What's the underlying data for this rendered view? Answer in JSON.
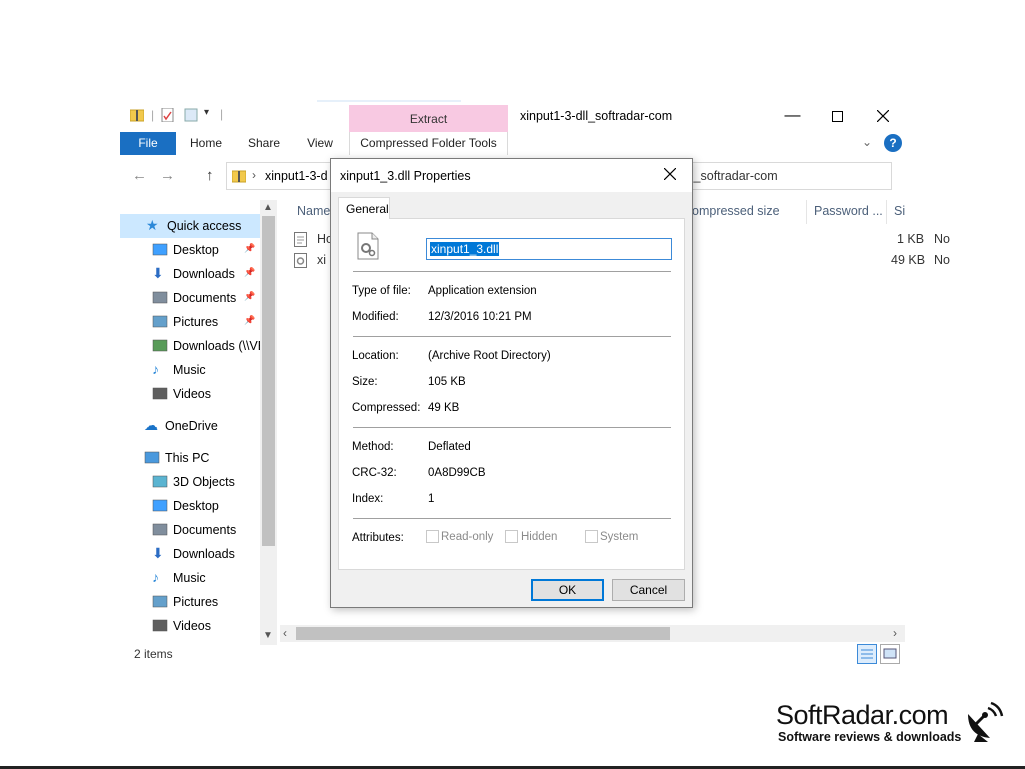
{
  "explorer": {
    "title": "xinput1-3-dll_softradar-com",
    "context_tab": "Extract",
    "context_group": "Compressed Folder Tools",
    "tabs": [
      "File",
      "Home",
      "Share",
      "View"
    ],
    "address_left": "xinput1-3-d",
    "address_right": "ll_softradar-com",
    "columns": {
      "name": "Name",
      "compressed_size": "ompressed size",
      "password": "Password ...",
      "size": "Si"
    },
    "files": [
      {
        "name": "Ho",
        "compressed_size": "1 KB",
        "password": "No"
      },
      {
        "name": "xi",
        "compressed_size": "49 KB",
        "password": "No"
      }
    ],
    "nav": [
      {
        "label": "Quick access",
        "icon": "star-icon",
        "pinned": false
      },
      {
        "label": "Desktop",
        "icon": "desktop-icon",
        "pinned": true
      },
      {
        "label": "Downloads",
        "icon": "download-arrow-icon",
        "pinned": true
      },
      {
        "label": "Documents",
        "icon": "document-icon",
        "pinned": true
      },
      {
        "label": "Pictures",
        "icon": "pictures-icon",
        "pinned": true
      },
      {
        "label": "Downloads (\\\\VE",
        "icon": "network-drive-icon",
        "pinned": false
      },
      {
        "label": "Music",
        "icon": "music-note-icon",
        "pinned": false
      },
      {
        "label": "Videos",
        "icon": "video-film-icon",
        "pinned": false
      },
      {
        "label": "OneDrive",
        "icon": "cloud-icon",
        "pinned": false
      },
      {
        "label": "This PC",
        "icon": "computer-icon",
        "pinned": false
      },
      {
        "label": "3D Objects",
        "icon": "cube-icon",
        "pinned": false
      },
      {
        "label": "Desktop",
        "icon": "desktop-icon",
        "pinned": false
      },
      {
        "label": "Documents",
        "icon": "document-icon",
        "pinned": false
      },
      {
        "label": "Downloads",
        "icon": "download-arrow-icon",
        "pinned": false
      },
      {
        "label": "Music",
        "icon": "music-note-icon",
        "pinned": false
      },
      {
        "label": "Pictures",
        "icon": "pictures-icon",
        "pinned": false
      },
      {
        "label": "Videos",
        "icon": "video-film-icon",
        "pinned": false
      }
    ],
    "status": "2 items"
  },
  "dialog": {
    "title": "xinput1_3.dll Properties",
    "tab": "General",
    "filename": "xinput1_3.dll",
    "props": {
      "type_label": "Type of file:",
      "type_value": "Application extension",
      "modified_label": "Modified:",
      "modified_value": "12/3/2016 10:21 PM",
      "location_label": "Location:",
      "location_value": "(Archive Root Directory)",
      "size_label": "Size:",
      "size_value": "105 KB",
      "compressed_label": "Compressed:",
      "compressed_value": "49 KB",
      "method_label": "Method:",
      "method_value": "Deflated",
      "crc_label": "CRC-32:",
      "crc_value": "0A8D99CB",
      "index_label": "Index:",
      "index_value": "1",
      "attributes_label": "Attributes:"
    },
    "attributes": {
      "readonly": "Read-only",
      "hidden": "Hidden",
      "system": "System"
    },
    "ok": "OK",
    "cancel": "Cancel"
  },
  "watermark": {
    "brand": "SoftRadar.com",
    "tagline": "Software reviews & downloads"
  },
  "colors": {
    "accent": "#0078d7",
    "file_tab": "#1a6fc2",
    "context_tab": "#f8c9e2",
    "nav_selected": "#cce8ff"
  }
}
